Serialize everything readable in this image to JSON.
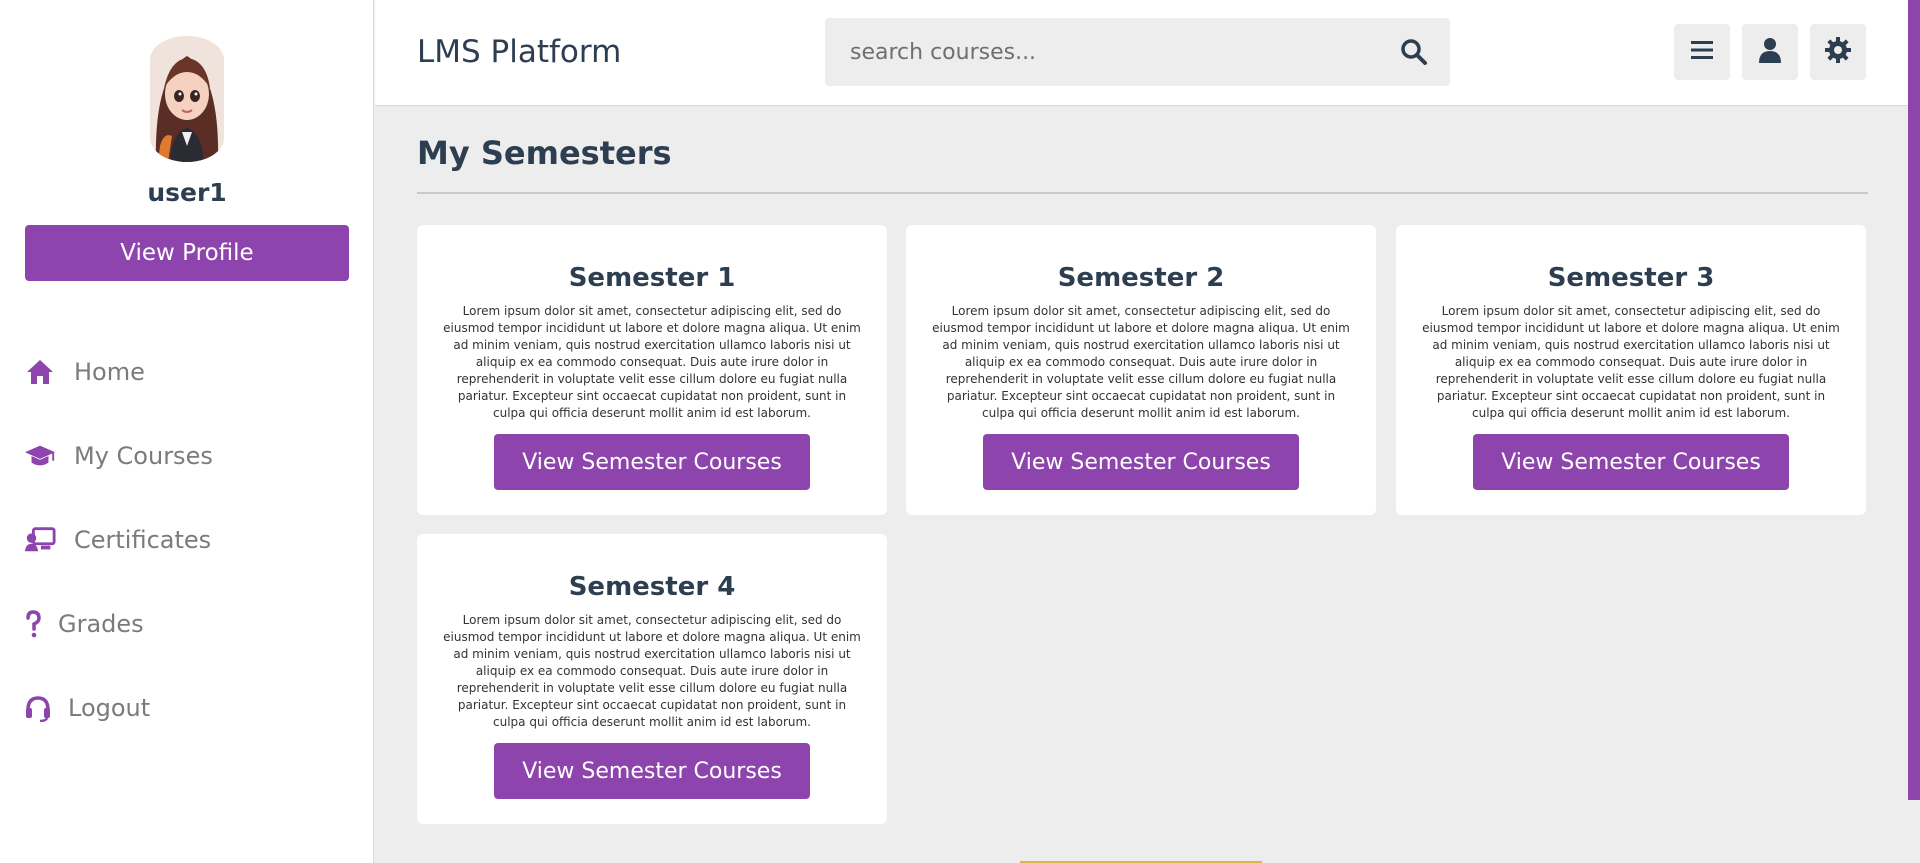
{
  "sidebar": {
    "username": "user1",
    "view_profile_label": "View Profile",
    "nav": [
      {
        "label": "Home",
        "icon": "home-icon"
      },
      {
        "label": "My Courses",
        "icon": "graduation-cap-icon"
      },
      {
        "label": "Certificates",
        "icon": "certificate-icon"
      },
      {
        "label": "Grades",
        "icon": "question-mark-icon"
      },
      {
        "label": "Logout",
        "icon": "headset-icon"
      }
    ]
  },
  "header": {
    "title": "LMS Platform",
    "search_placeholder": "search courses...",
    "buttons": [
      "menu-icon",
      "user-icon",
      "settings-icon"
    ]
  },
  "main": {
    "title": "My Semesters",
    "semesters": [
      {
        "title": "Semester 1",
        "text": "Lorem ipsum dolor sit amet, consectetur adipiscing elit, sed do eiusmod tempor incididunt ut labore et dolore magna aliqua. Ut enim ad minim veniam, quis nostrud exercitation ullamco laboris nisi ut aliquip ex ea commodo consequat. Duis aute irure dolor in reprehenderit in voluptate velit esse cillum dolore eu fugiat nulla pariatur. Excepteur sint occaecat cupidatat non proident, sunt in culpa qui officia deserunt mollit anim id est laborum.",
        "button": "View Semester Courses"
      },
      {
        "title": "Semester 2",
        "text": "Lorem ipsum dolor sit amet, consectetur adipiscing elit, sed do eiusmod tempor incididunt ut labore et dolore magna aliqua. Ut enim ad minim veniam, quis nostrud exercitation ullamco laboris nisi ut aliquip ex ea commodo consequat. Duis aute irure dolor in reprehenderit in voluptate velit esse cillum dolore eu fugiat nulla pariatur. Excepteur sint occaecat cupidatat non proident, sunt in culpa qui officia deserunt mollit anim id est laborum.",
        "button": "View Semester Courses"
      },
      {
        "title": "Semester 3",
        "text": "Lorem ipsum dolor sit amet, consectetur adipiscing elit, sed do eiusmod tempor incididunt ut labore et dolore magna aliqua. Ut enim ad minim veniam, quis nostrud exercitation ullamco laboris nisi ut aliquip ex ea commodo consequat. Duis aute irure dolor in reprehenderit in voluptate velit esse cillum dolore eu fugiat nulla pariatur. Excepteur sint occaecat cupidatat non proident, sunt in culpa qui officia deserunt mollit anim id est laborum.",
        "button": "View Semester Courses"
      },
      {
        "title": "Semester 4",
        "text": "Lorem ipsum dolor sit amet, consectetur adipiscing elit, sed do eiusmod tempor incididunt ut labore et dolore magna aliqua. Ut enim ad minim veniam, quis nostrud exercitation ullamco laboris nisi ut aliquip ex ea commodo consequat. Duis aute irure dolor in reprehenderit in voluptate velit esse cillum dolore eu fugiat nulla pariatur. Excepteur sint occaecat cupidatat non proident, sunt in culpa qui officia deserunt mollit anim id est laborum.",
        "button": "View Semester Courses"
      }
    ]
  },
  "colors": {
    "accent": "#8e44ad",
    "text_dark": "#2c3e50",
    "background": "#ededed"
  }
}
